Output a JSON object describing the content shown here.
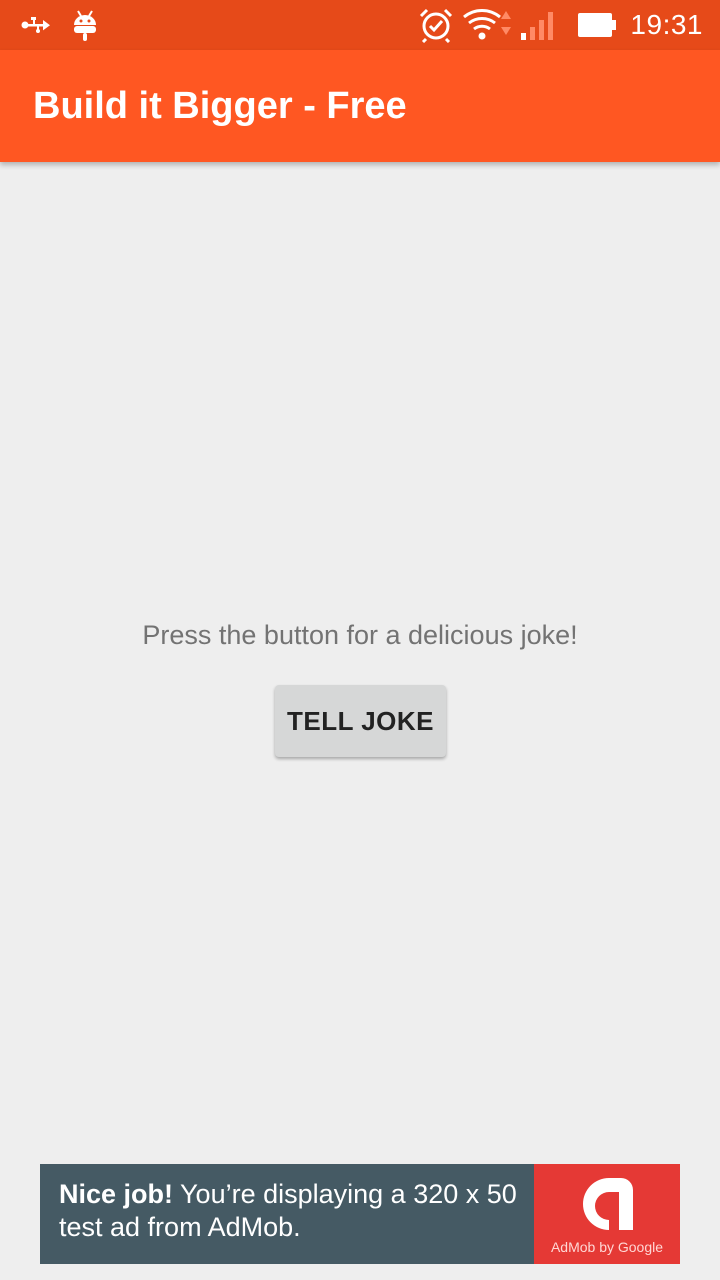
{
  "status_bar": {
    "time": "19:31",
    "icons": [
      "usb-icon",
      "android-debug-icon",
      "alarm-icon",
      "wifi-icon",
      "signal-icon",
      "battery-icon"
    ]
  },
  "app_bar": {
    "title": "Build it Bigger - Free"
  },
  "main": {
    "instructions": "Press the button for a delicious joke!",
    "tell_joke_button": "TELL JOKE"
  },
  "ad": {
    "headline": "Nice job!",
    "body": " You’re displaying a 320 x 50 test ad from AdMob.",
    "logo_caption": "AdMob by Google"
  },
  "colors": {
    "status_bar": "#e64a19",
    "app_bar": "#ff5722",
    "background": "#eeeeee",
    "button": "#d6d7d7",
    "ad_background": "#455a64",
    "ad_logo": "#e53935"
  }
}
